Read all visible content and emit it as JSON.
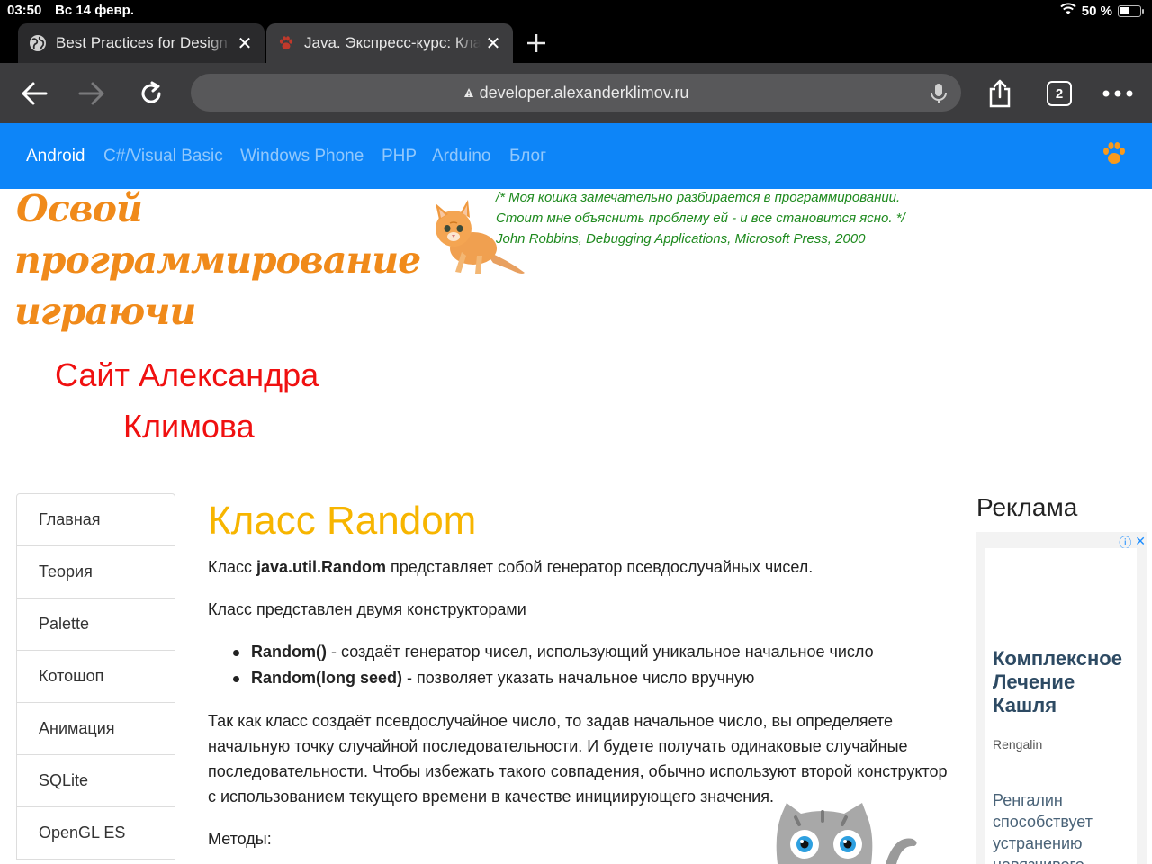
{
  "status_bar": {
    "time": "03:50",
    "date": "Вс 14 февр.",
    "battery": "50 %",
    "icons": [
      "wifi-icon",
      "battery-icon"
    ]
  },
  "tabs": [
    {
      "title": "Best Practices for Design",
      "icon": "globe-icon",
      "active": false
    },
    {
      "title": "Java. Экспресс-курс: Класс",
      "icon": "paw-icon",
      "active": true
    }
  ],
  "toolbar": {
    "url": "developer.alexanderklimov.ru",
    "tab_count": "2",
    "icons": [
      "back-icon",
      "forward-icon",
      "reload-icon",
      "lock-icon",
      "mic-icon",
      "share-icon",
      "tabs-icon",
      "more-icon"
    ]
  },
  "colors": {
    "nav_bg": "#0d85f8",
    "logo": "#f08a1a",
    "site_name": "#f01010",
    "quote": "#1e8a1e",
    "heading": "#f7b500",
    "ad_link": "#1a8cff"
  },
  "nav": {
    "items": [
      "Android",
      "C#/Visual Basic",
      "Windows Phone",
      "PHP",
      "Arduino",
      "Блог"
    ],
    "active": "Android"
  },
  "header": {
    "logo_lines": [
      "Освой",
      "программирование",
      "играючи"
    ],
    "site_name_lines": [
      "Сайт Александра",
      "Климова"
    ],
    "quote_lines": [
      "/* Моя кошка замечательно разбирается в программировании.",
      "Стоит мне объяснить проблему ей - и все становится ясно. */",
      "John Robbins, Debugging Applications, Microsoft Press, 2000"
    ]
  },
  "sidebar": {
    "items": [
      "Главная",
      "Теория",
      "Palette",
      "Котошоп",
      "Анимация",
      "SQLite",
      "OpenGL ES"
    ]
  },
  "article": {
    "title": "Класс Random",
    "p1_prefix": "Класс ",
    "p1_bold": "java.util.Random",
    "p1_suffix": " представляет собой генератор псевдослучайных чисел.",
    "p2": "Класс представлен двумя конструкторами",
    "list": [
      {
        "bold": "Random()",
        "text": " - создаёт генератор чисел, использующий уникальное начальное число"
      },
      {
        "bold": "Random(long seed)",
        "text": " - позволяет указать начальное число вручную"
      }
    ],
    "p3": "Так как класс создаёт псевдослучайное число, то задав начальное число, вы определяете начальную точку случайной последовательности. И будете получать одинаковые случайные последовательности. Чтобы избежать такого совпадения, обычно используют второй конструктор с использованием текущего времени в качестве инициирующего значения.",
    "p4": "Методы:"
  },
  "ad": {
    "heading": "Реклама",
    "title": "Комплексное Лечение Кашля",
    "brand": "Rengalin",
    "text": "Ренгалин способствует устранению навязчивого"
  }
}
